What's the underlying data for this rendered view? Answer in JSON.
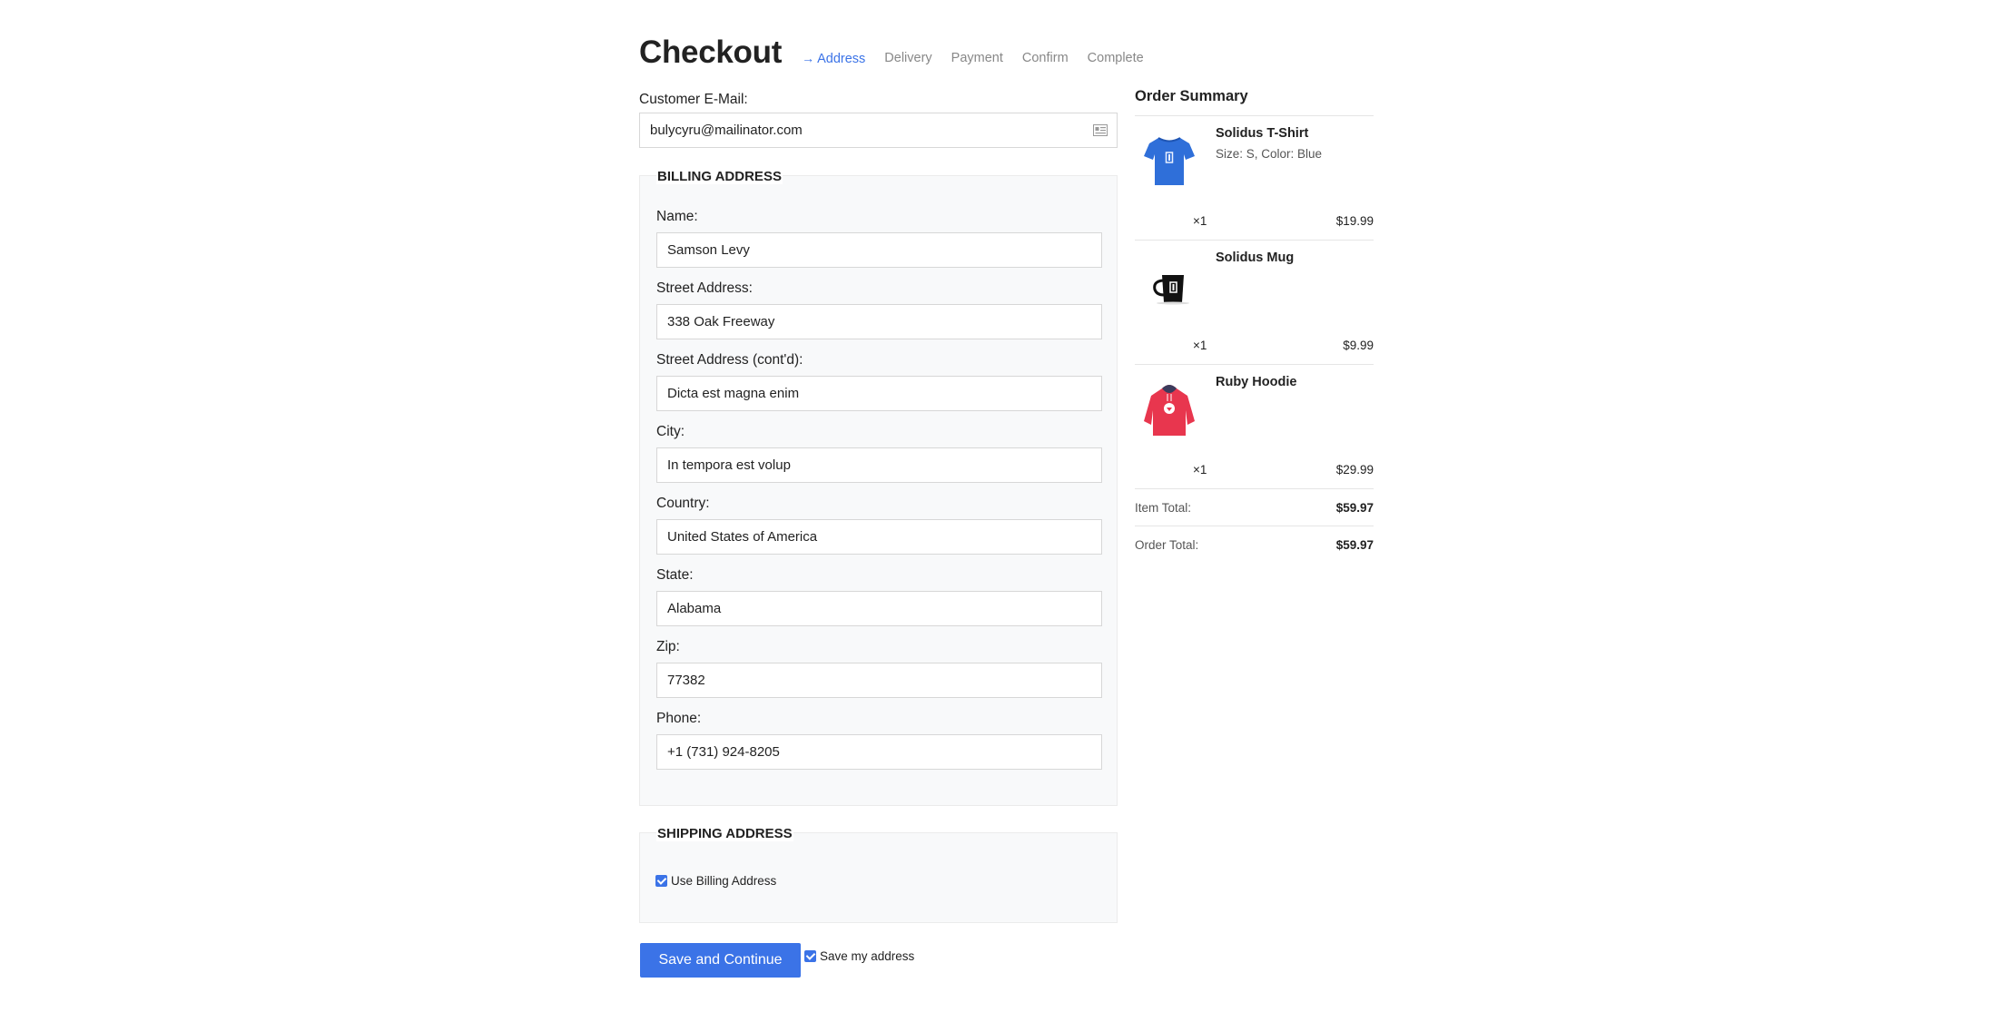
{
  "page_title": "Checkout",
  "steps": [
    {
      "label": "Address",
      "active": true
    },
    {
      "label": "Delivery",
      "active": false
    },
    {
      "label": "Payment",
      "active": false
    },
    {
      "label": "Confirm",
      "active": false
    },
    {
      "label": "Complete",
      "active": false
    }
  ],
  "email": {
    "label": "Customer E-Mail:",
    "value": "bulycyru@mailinator.com"
  },
  "billing": {
    "legend": "Billing Address",
    "fields": [
      {
        "label": "Name:",
        "value": "Samson Levy"
      },
      {
        "label": "Street Address:",
        "value": "338 Oak Freeway"
      },
      {
        "label": "Street Address (cont'd):",
        "value": "Dicta est magna enim"
      },
      {
        "label": "City:",
        "value": "In tempora est volup"
      },
      {
        "label": "Country:",
        "value": "United States of America"
      },
      {
        "label": "State:",
        "value": "Alabama"
      },
      {
        "label": "Zip:",
        "value": "77382"
      },
      {
        "label": "Phone:",
        "value": "+1 (731) 924-8205"
      }
    ]
  },
  "shipping": {
    "legend": "Shipping Address",
    "use_billing_label": "Use Billing Address",
    "use_billing_checked": true
  },
  "actions": {
    "save_continue": "Save and Continue",
    "save_address_label": "Save my address",
    "save_address_checked": true
  },
  "summary": {
    "title": "Order Summary",
    "items": [
      {
        "name": "Solidus T-Shirt",
        "variant": "Size: S, Color: Blue",
        "qty": "×1",
        "price": "$19.99",
        "image": "tshirt-image"
      },
      {
        "name": "Solidus Mug",
        "variant": "",
        "qty": "×1",
        "price": "$9.99",
        "image": "mug-image"
      },
      {
        "name": "Ruby Hoodie",
        "variant": "",
        "qty": "×1",
        "price": "$29.99",
        "image": "hoodie-image"
      }
    ],
    "item_total_label": "Item Total:",
    "item_total": "$59.97",
    "order_total_label": "Order Total:",
    "order_total": "$59.97"
  },
  "colors": {
    "accent": "#3b73e7",
    "panel": "#f8f9fa"
  }
}
